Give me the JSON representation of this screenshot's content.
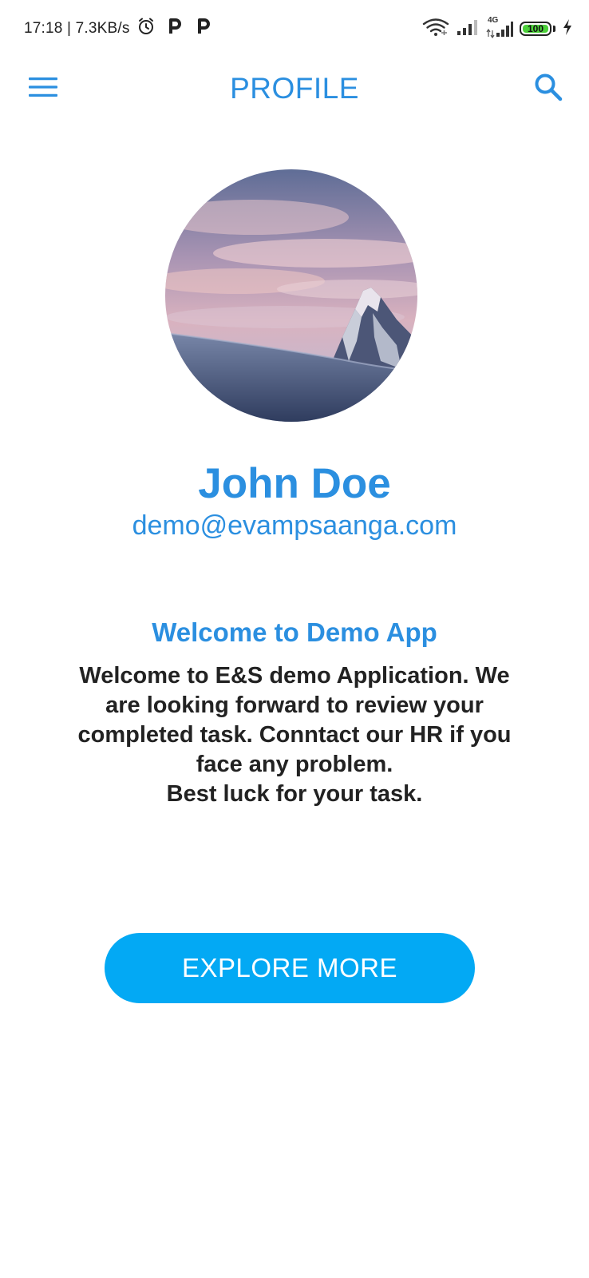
{
  "status_bar": {
    "time_and_speed": "17:18 | 7.3KB/s",
    "network_label": "4G",
    "battery_level": "100",
    "icons": [
      "alarm-icon",
      "p-app-icon",
      "p-app-icon",
      "wifi-icon",
      "signal-icon",
      "signal-4g-icon",
      "battery-icon",
      "charging-icon"
    ]
  },
  "app_bar": {
    "title": "PROFILE",
    "left_icon": "menu-icon",
    "right_icon": "search-icon"
  },
  "profile": {
    "avatar_icon": "mountain-avatar-image",
    "name": "John Doe",
    "email": "demo@evampsaanga.com"
  },
  "welcome": {
    "title": "Welcome to Demo App",
    "lines": [
      "Welcome to E&S demo Application. We",
      "are looking forward to review your",
      "completed task. Conntact our HR if you",
      "face any problem.",
      "Best luck for your task."
    ]
  },
  "cta": {
    "label": "EXPLORE MORE"
  },
  "colors": {
    "accent": "#2b8fe0",
    "button": "#03a9f4",
    "text": "#222222",
    "background": "#ffffff"
  }
}
